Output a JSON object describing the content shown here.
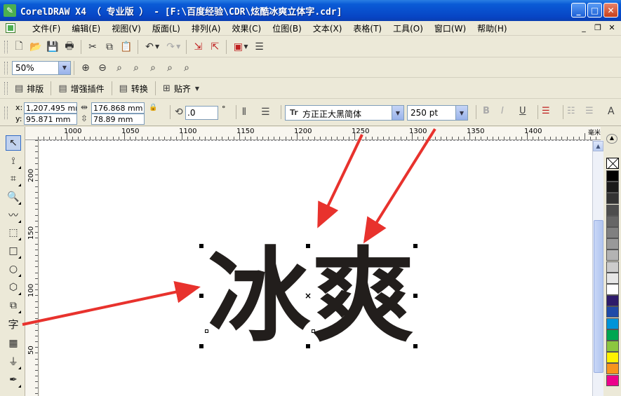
{
  "window": {
    "title": "CorelDRAW X4 （ 专业版 ） - [F:\\百度经验\\CDR\\炫酷冰爽立体字.cdr]",
    "minimize": "_",
    "maximize": "□",
    "close": "✕"
  },
  "menu": {
    "items": [
      "文件(F)",
      "编辑(E)",
      "视图(V)",
      "版面(L)",
      "排列(A)",
      "效果(C)",
      "位图(B)",
      "文本(X)",
      "表格(T)",
      "工具(O)",
      "窗口(W)",
      "帮助(H)"
    ],
    "doc_controls": [
      "_",
      "❐",
      "✕"
    ]
  },
  "standard_toolbar": {
    "icons": [
      "new-icon",
      "open-icon",
      "save-icon",
      "print-icon",
      "cut-icon",
      "copy-icon",
      "paste-icon",
      "undo-icon",
      "redo-icon",
      "import-icon",
      "export-icon",
      "launcher-icon",
      "options-icon"
    ]
  },
  "zoom_toolbar": {
    "zoom_value": "50%"
  },
  "plugin_toolbar": {
    "buttons": [
      "排版",
      "增强插件",
      "转换",
      "贴齐"
    ]
  },
  "property_bar": {
    "x_label": "x:",
    "y_label": "y:",
    "x_value": "1,207.495 mm",
    "y_value": "95.871 mm",
    "width_value": "176.868 mm",
    "height_value": "78.89 mm",
    "rotation_value": ".0",
    "degree_symbol": "°",
    "font_name": "方正正大黑简体",
    "font_icon": "Tr",
    "font_size": "250 pt",
    "bold": "B",
    "italic": "I",
    "underline": "U"
  },
  "ruler": {
    "h_labels": [
      "1000",
      "1050",
      "1100",
      "1150",
      "1200",
      "1250",
      "1300",
      "1350",
      "1400"
    ],
    "v_labels": [
      "200",
      "150",
      "100",
      "50"
    ],
    "unit": "毫米"
  },
  "toolbox": {
    "text_tool": "字"
  },
  "canvas": {
    "text": "冰爽",
    "char1": "冰",
    "char2": "爽",
    "center_mark": "×"
  },
  "palette": {
    "colors": [
      "#000000",
      "#1a1a1a",
      "#333333",
      "#4d4d4d",
      "#666666",
      "#808080",
      "#999999",
      "#b3b3b3",
      "#cccccc",
      "#e6e6e6",
      "#ffffff",
      "#2e1b6b",
      "#1f4aa8",
      "#0094d9",
      "#00a651",
      "#8cc63f",
      "#fff200",
      "#f7941d",
      "#ec008c",
      "#ed1c24",
      "#f26522"
    ]
  },
  "annotation": {
    "arrow_color": "#e8322d"
  }
}
